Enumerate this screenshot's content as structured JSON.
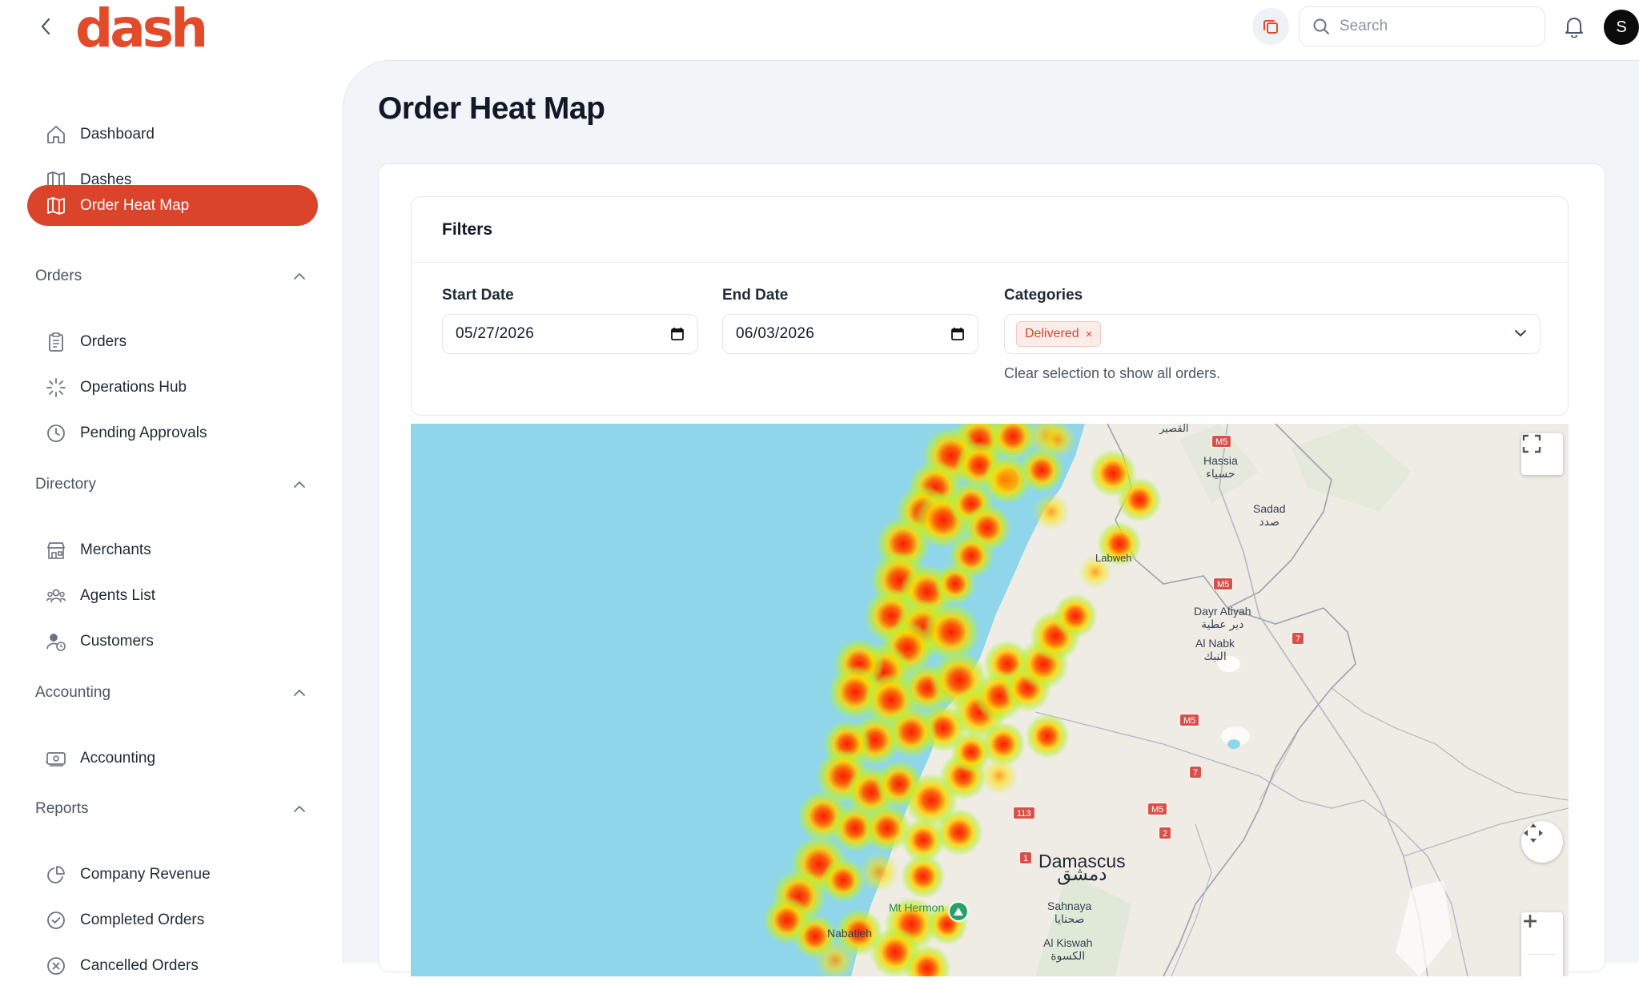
{
  "header": {
    "logo_text": "dash",
    "search_placeholder": "Search",
    "avatar_initial": "S"
  },
  "sidebar": {
    "top_items": [
      {
        "label": "Dashboard",
        "icon": "home-icon"
      },
      {
        "label": "Dashes",
        "icon": "map-icon"
      },
      {
        "label": "Order Heat Map",
        "icon": "map-icon",
        "active": true
      }
    ],
    "sections": [
      {
        "title": "Orders",
        "items": [
          {
            "label": "Orders",
            "icon": "clipboard-icon"
          },
          {
            "label": "Operations Hub",
            "icon": "loader-icon"
          },
          {
            "label": "Pending Approvals",
            "icon": "clock-icon"
          }
        ]
      },
      {
        "title": "Directory",
        "items": [
          {
            "label": "Merchants",
            "icon": "store-icon"
          },
          {
            "label": "Agents List",
            "icon": "users-icon"
          },
          {
            "label": "Customers",
            "icon": "user-clock-icon"
          }
        ]
      },
      {
        "title": "Accounting",
        "items": [
          {
            "label": "Accounting",
            "icon": "banknote-icon"
          }
        ]
      },
      {
        "title": "Reports",
        "items": [
          {
            "label": "Company Revenue",
            "icon": "pie-chart-icon"
          },
          {
            "label": "Completed Orders",
            "icon": "check-circle-icon"
          },
          {
            "label": "Cancelled Orders",
            "icon": "x-circle-icon"
          }
        ]
      }
    ]
  },
  "page": {
    "title": "Order Heat Map",
    "filters": {
      "heading": "Filters",
      "start_date_label": "Start Date",
      "start_date_value": "05/27/2026",
      "end_date_label": "End Date",
      "end_date_value": "06/03/2026",
      "categories_label": "Categories",
      "selected_category": "Delivered",
      "chip_remove": "×",
      "hint": "Clear selection to show all orders."
    }
  },
  "map": {
    "labels": {
      "damascus": "Damascus",
      "damascus_ar": "دمشق",
      "hassia": "Hassia",
      "hassia_ar": "حسياء",
      "sadad": "Sadad",
      "sadad_ar": "صدد",
      "dayr_atiyah": "Dayr Atiyah",
      "dayr_atiyah_ar": "دير عطية",
      "al_nabk": "Al Nabk",
      "al_nabk_ar": "النبك",
      "sahnaya": "Sahnaya",
      "sahnaya_ar": "صحنايا",
      "al_kiswah": "Al Kiswah",
      "al_kiswah_ar": "الكسوة",
      "mt_hermon": "Mt Hermon",
      "nabatieh": "Nabatieh",
      "labweh": "Labweh",
      "qusayr_ar": "القصير"
    },
    "road_badges": [
      "M5",
      "M5",
      "M5",
      "M5",
      "7",
      "7",
      "2",
      "113",
      "1"
    ],
    "colors": {
      "sea": "#8fd6ea",
      "land": "#efece5",
      "heat_core": "#ff1a00",
      "heat_mid": "#ffd400",
      "heat_outer": "#b6f03a"
    }
  }
}
